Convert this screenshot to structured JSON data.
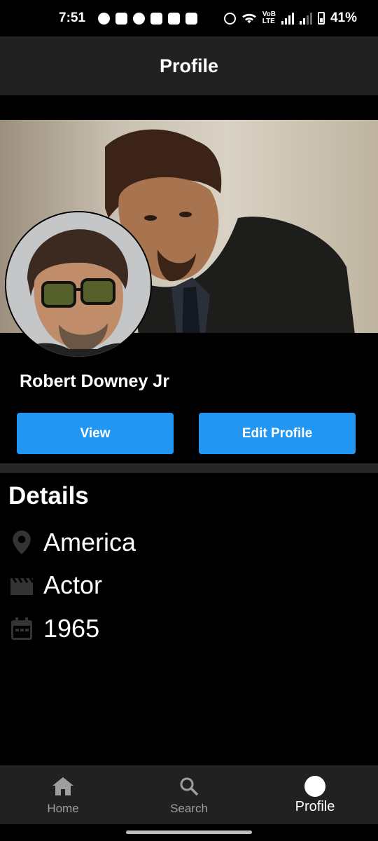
{
  "status_bar": {
    "time": "7:51",
    "battery": "41%"
  },
  "app_bar": {
    "title": "Profile"
  },
  "profile": {
    "name": "Robert Downey Jr"
  },
  "actions": {
    "view_label": "View",
    "edit_label": "Edit Profile"
  },
  "details": {
    "title": "Details",
    "items": [
      {
        "icon": "location-pin-icon",
        "text": "America"
      },
      {
        "icon": "movie-clapper-icon",
        "text": "Actor"
      },
      {
        "icon": "calendar-icon",
        "text": "1965"
      }
    ]
  },
  "bottom_nav": {
    "items": [
      {
        "icon": "home-icon",
        "label": "Home"
      },
      {
        "icon": "search-icon",
        "label": "Search"
      },
      {
        "icon": "profile-icon",
        "label": "Profile"
      }
    ]
  },
  "colors": {
    "accent": "#2196f3",
    "bar": "#212121",
    "background": "#000000"
  }
}
